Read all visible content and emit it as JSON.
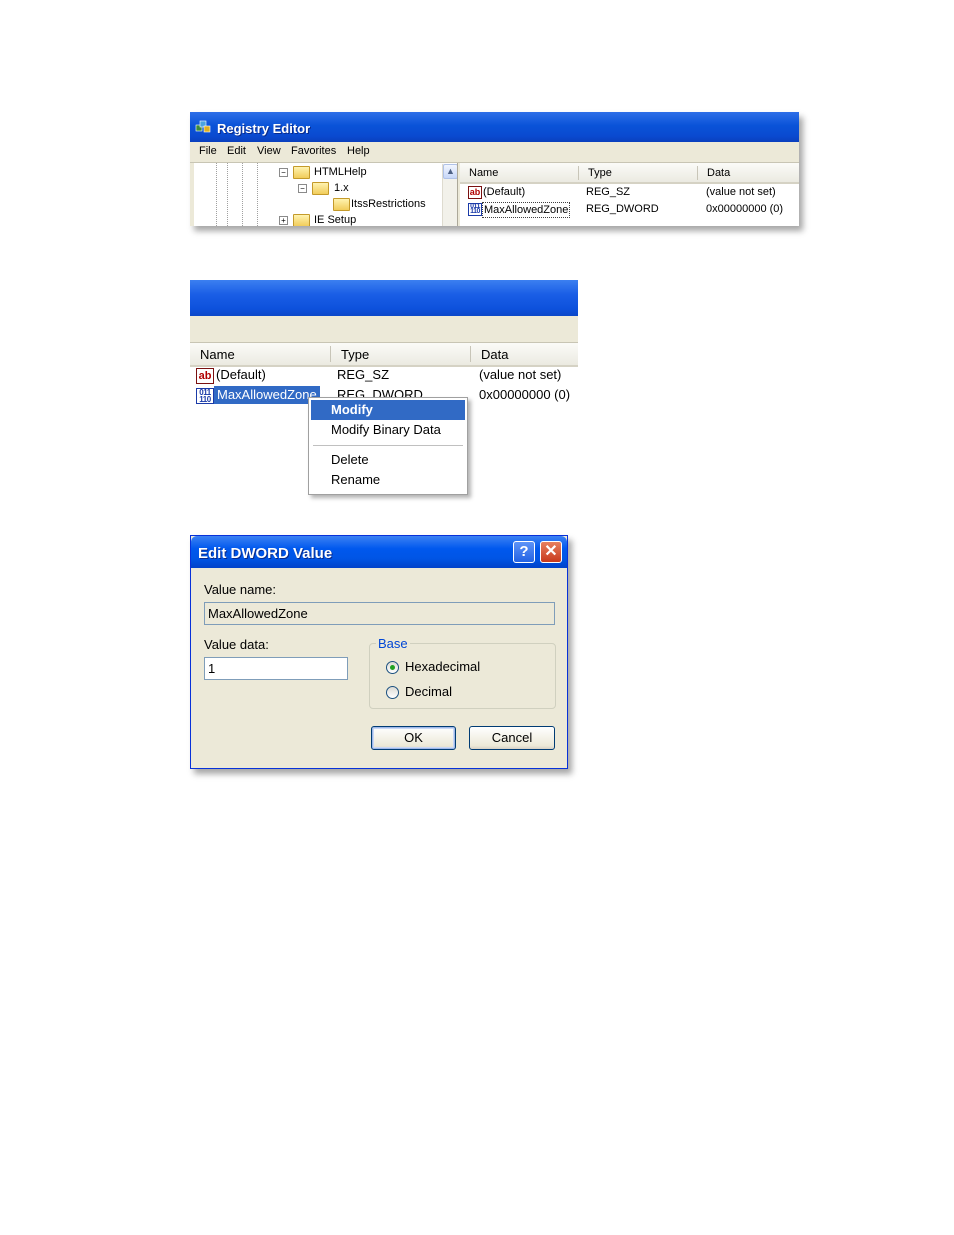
{
  "regedit": {
    "title": "Registry Editor",
    "menu": [
      "File",
      "Edit",
      "View",
      "Favorites",
      "Help"
    ],
    "tree": [
      {
        "label": "HTMLHelp",
        "expander": "−"
      },
      {
        "label": "1.x",
        "expander": "−"
      },
      {
        "label": "ItssRestrictions",
        "expander": ""
      },
      {
        "label": "IE Setup",
        "expander": "+"
      }
    ],
    "columns": [
      "Name",
      "Type",
      "Data"
    ],
    "rows": [
      {
        "name": "(Default)",
        "type": "REG_SZ",
        "data": "(value not set)",
        "icon": "ab-icon"
      },
      {
        "name": "MaxAllowedZone",
        "type": "REG_DWORD",
        "data": "0x00000000 (0)",
        "icon": "binary-value-icon"
      }
    ]
  },
  "context_shot": {
    "columns": [
      "Name",
      "Type",
      "Data"
    ],
    "rows": [
      {
        "name": "(Default)",
        "type": "REG_SZ",
        "data": "(value not set)"
      },
      {
        "name": "MaxAllowedZone",
        "type": "REG_DWORD",
        "data": "0x00000000 (0)"
      }
    ],
    "menu_items": [
      "Modify",
      "Modify Binary Data",
      "Delete",
      "Rename"
    ]
  },
  "dialog": {
    "title": "Edit DWORD Value",
    "help_glyph": "?",
    "close_glyph": "✕",
    "value_name_label": "Value name:",
    "value_name": "MaxAllowedZone",
    "value_data_label": "Value data:",
    "value_data": "1",
    "base_label": "Base",
    "base_options": [
      "Hexadecimal",
      "Decimal"
    ],
    "base_selected": "Hexadecimal",
    "ok_label": "OK",
    "cancel_label": "Cancel"
  },
  "colors": {
    "xp_title_blue": "#0a53d8",
    "menu_highlight": "#316ac5",
    "dialog_face": "#ece9d8",
    "group_title": "#0046d5"
  }
}
